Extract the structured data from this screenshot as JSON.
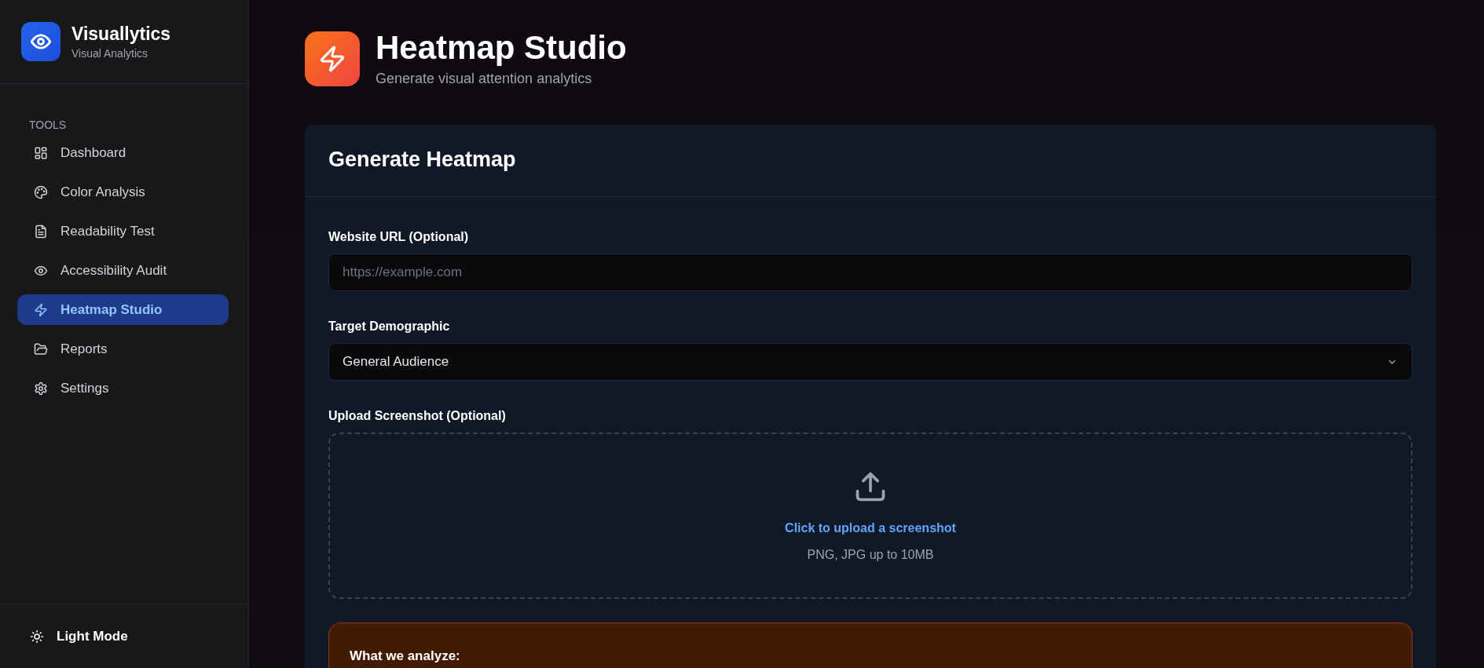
{
  "brand": {
    "name": "Visuallytics",
    "tagline": "Visual Analytics"
  },
  "sidebar": {
    "section": "TOOLS",
    "items": [
      {
        "label": "Dashboard",
        "selected": false
      },
      {
        "label": "Color Analysis",
        "selected": false
      },
      {
        "label": "Readability Test",
        "selected": false
      },
      {
        "label": "Accessibility Audit",
        "selected": false
      },
      {
        "label": "Heatmap Studio",
        "selected": true
      },
      {
        "label": "Reports",
        "selected": false
      },
      {
        "label": "Settings",
        "selected": false
      }
    ],
    "footer": {
      "label": "Light Mode"
    }
  },
  "header": {
    "title": "Heatmap Studio",
    "subtitle": "Generate visual attention analytics"
  },
  "card": {
    "title": "Generate Heatmap",
    "url_field": {
      "label": "Website URL (Optional)",
      "placeholder": "https://example.com"
    },
    "demographic": {
      "label": "Target Demographic",
      "value": "General Audience"
    },
    "upload": {
      "label": "Upload Screenshot (Optional)",
      "link": "Click to upload a screenshot",
      "hint": "PNG, JPG up to 10MB"
    },
    "info": {
      "title": "What we analyze:"
    }
  }
}
